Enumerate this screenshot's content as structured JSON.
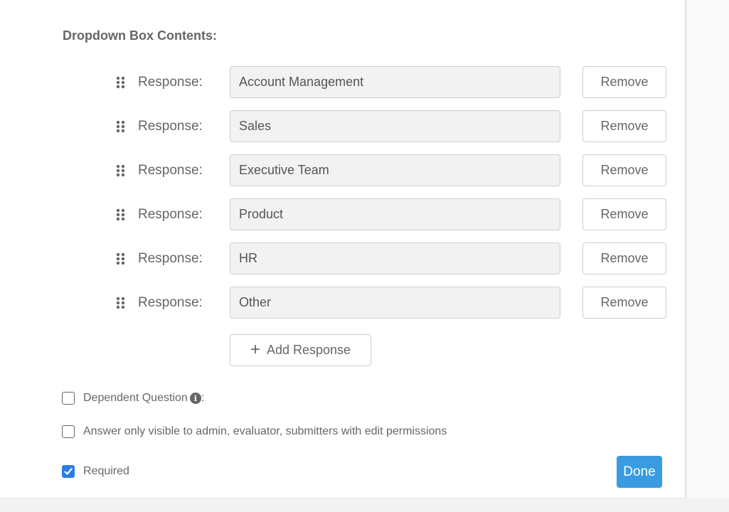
{
  "section": {
    "title": "Dropdown Box Contents:"
  },
  "responses": [
    {
      "label": "Response:",
      "value": "Account Management",
      "remove_label": "Remove"
    },
    {
      "label": "Response:",
      "value": "Sales",
      "remove_label": "Remove"
    },
    {
      "label": "Response:",
      "value": "Executive Team",
      "remove_label": "Remove"
    },
    {
      "label": "Response:",
      "value": "Product",
      "remove_label": "Remove"
    },
    {
      "label": "Response:",
      "value": "HR",
      "remove_label": "Remove"
    },
    {
      "label": "Response:",
      "value": "Other",
      "remove_label": "Remove"
    }
  ],
  "add_response": {
    "icon": "plus-icon",
    "label": "Add Response"
  },
  "options": {
    "dependent_question": {
      "label": "Dependent Question",
      "suffix": ":",
      "checked": false,
      "info_icon": "info-icon"
    },
    "visibility": {
      "label": "Answer only visible to admin, evaluator, submitters with edit permissions",
      "checked": false
    },
    "required": {
      "label": "Required",
      "checked": true
    }
  },
  "done_label": "Done",
  "colors": {
    "accent": "#3a9be0",
    "checkbox_checked": "#2b7de9",
    "input_bg": "#f2f2f2"
  }
}
